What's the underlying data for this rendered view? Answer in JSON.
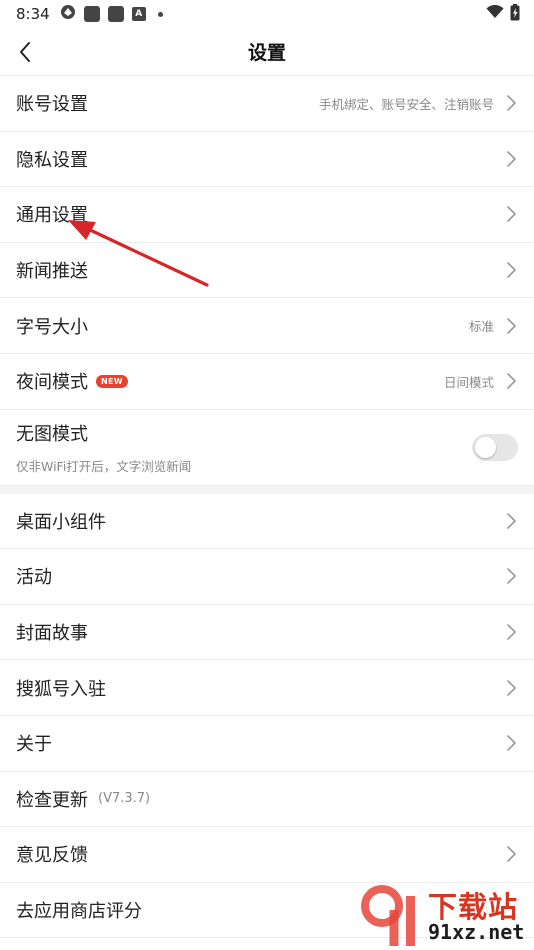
{
  "status_bar": {
    "time": "8:34",
    "icons": [
      "navigation-icon",
      "app-square-icon",
      "app-square-icon",
      "a-letter-icon",
      "dot-icon",
      "wifi-icon",
      "battery-charging-icon"
    ]
  },
  "nav": {
    "title": "设置",
    "back_icon": "chevron-left-icon"
  },
  "settings_group_1": [
    {
      "label": "账号设置",
      "hint": "手机绑定、账号安全、注销账号",
      "chevron": true
    },
    {
      "label": "隐私设置",
      "hint": "",
      "chevron": true
    },
    {
      "label": "通用设置",
      "hint": "",
      "chevron": true
    },
    {
      "label": "新闻推送",
      "hint": "",
      "chevron": true
    },
    {
      "label": "字号大小",
      "hint": "标准",
      "chevron": true
    },
    {
      "label": "夜间模式",
      "badge": "NEW",
      "hint": "日间模式",
      "chevron": true
    }
  ],
  "no_image_mode": {
    "label": "无图模式",
    "sub": "仅非WiFi打开后，文字浏览新闻",
    "enabled": false
  },
  "settings_group_2": [
    {
      "label": "桌面小组件",
      "chevron": true
    },
    {
      "label": "活动",
      "chevron": true
    },
    {
      "label": "封面故事",
      "chevron": true
    },
    {
      "label": "搜狐号入驻",
      "chevron": true
    },
    {
      "label": "关于",
      "chevron": true
    },
    {
      "label": "检查更新",
      "version": "(V7.3.7)",
      "chevron": false
    },
    {
      "label": "意见反馈",
      "chevron": true
    },
    {
      "label": "去应用商店评分",
      "chevron": false
    }
  ],
  "watermark": {
    "line1": "下载站",
    "line2": "91xz.net",
    "logo_icon": "91-logo-icon"
  },
  "colors": {
    "accent_red": "#e8412c",
    "arrow_red": "#d7262a",
    "divider": "#ededed",
    "hint_gray": "#888888"
  }
}
